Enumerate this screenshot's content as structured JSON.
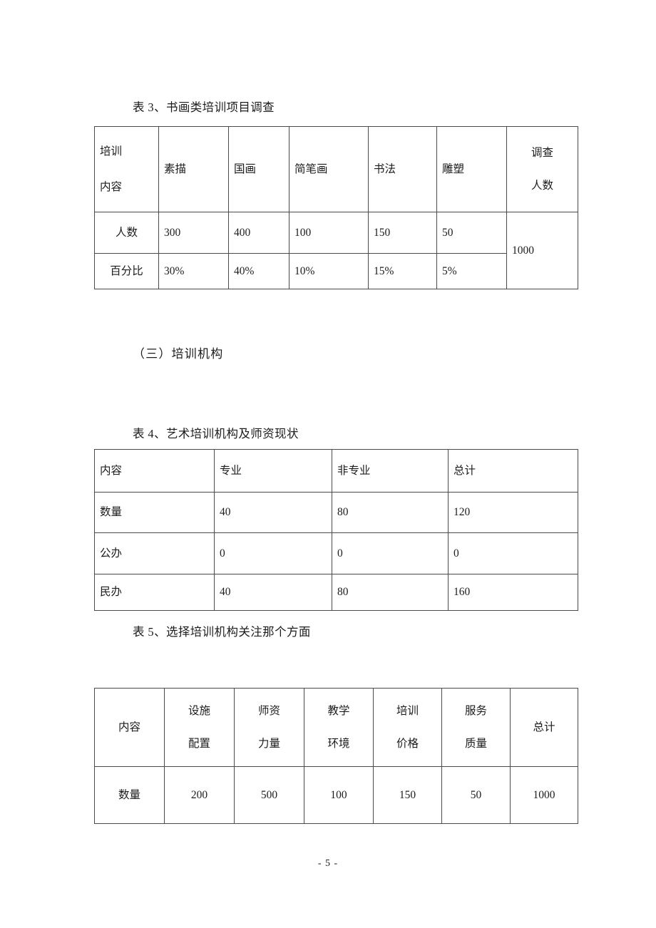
{
  "page": {
    "footer_page_number": "- 5 -"
  },
  "table3": {
    "caption": "表 3、书画类培训项目调查",
    "header": {
      "row_label_line1": "培训",
      "row_label_line2": "内容",
      "columns": [
        "素描",
        "国画",
        "简笔画",
        "书法",
        "雕塑"
      ],
      "total_line1": "调查",
      "total_line2": "人数"
    },
    "rows": [
      {
        "label": "人数",
        "values": [
          "300",
          "400",
          "100",
          "150",
          "50"
        ],
        "total": "1000"
      },
      {
        "label": "百分比",
        "values": [
          "30%",
          "40%",
          "10%",
          "15%",
          "5%"
        ],
        "total": ""
      }
    ]
  },
  "section_heading": "（三）培训机构",
  "table4": {
    "caption": "表 4、艺术培训机构及师资现状",
    "header": [
      "内容",
      "专业",
      "非专业",
      "总计"
    ],
    "rows": [
      {
        "label": "数量",
        "values": [
          "40",
          "80",
          "120"
        ]
      },
      {
        "label": "公办",
        "values": [
          "0",
          "0",
          "0"
        ]
      },
      {
        "label": "民办",
        "values": [
          "40",
          "80",
          "160"
        ]
      }
    ]
  },
  "table5": {
    "caption": "表 5、选择培训机构关注那个方面",
    "header": [
      {
        "line1": "内容",
        "line2": ""
      },
      {
        "line1": "设施",
        "line2": "配置"
      },
      {
        "line1": "师资",
        "line2": "力量"
      },
      {
        "line1": "教学",
        "line2": "环境"
      },
      {
        "line1": "培训",
        "line2": "价格"
      },
      {
        "line1": "服务",
        "line2": "质量"
      },
      {
        "line1": "总计",
        "line2": ""
      }
    ],
    "rows": [
      {
        "label": "数量",
        "values": [
          "200",
          "500",
          "100",
          "150",
          "50",
          "1000"
        ]
      }
    ]
  }
}
